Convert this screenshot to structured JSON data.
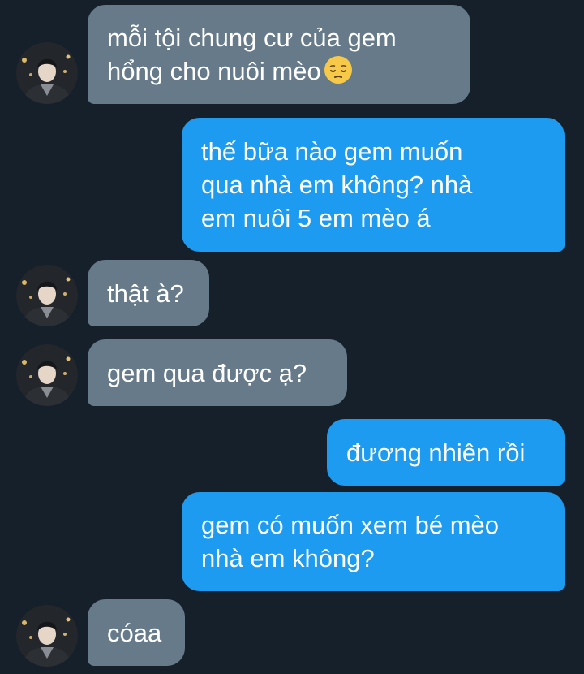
{
  "messages": [
    {
      "id": "m1",
      "side": "in",
      "text": "mỗi tội chung cư của gem\nhổng cho nuôi mèo",
      "emoji": "pensive-face"
    },
    {
      "id": "m2",
      "side": "out",
      "text": "thế bữa nào gem muốn\nqua nhà em không? nhà\nem nuôi 5 em mèo á"
    },
    {
      "id": "m3",
      "side": "in",
      "text": "thật à?"
    },
    {
      "id": "m4",
      "side": "in",
      "text": "gem qua được ạ?"
    },
    {
      "id": "m5",
      "side": "out",
      "text": "đương nhiên rồi"
    },
    {
      "id": "m6",
      "side": "out",
      "text": "gem có muốn xem bé mèo\nnhà em không?"
    },
    {
      "id": "m7",
      "side": "in",
      "text": "cóaa"
    }
  ],
  "colors": {
    "background": "#16202b",
    "incoming_bubble": "#667a8a",
    "outgoing_bubble": "#1d9bf0",
    "text": "#ffffff"
  }
}
